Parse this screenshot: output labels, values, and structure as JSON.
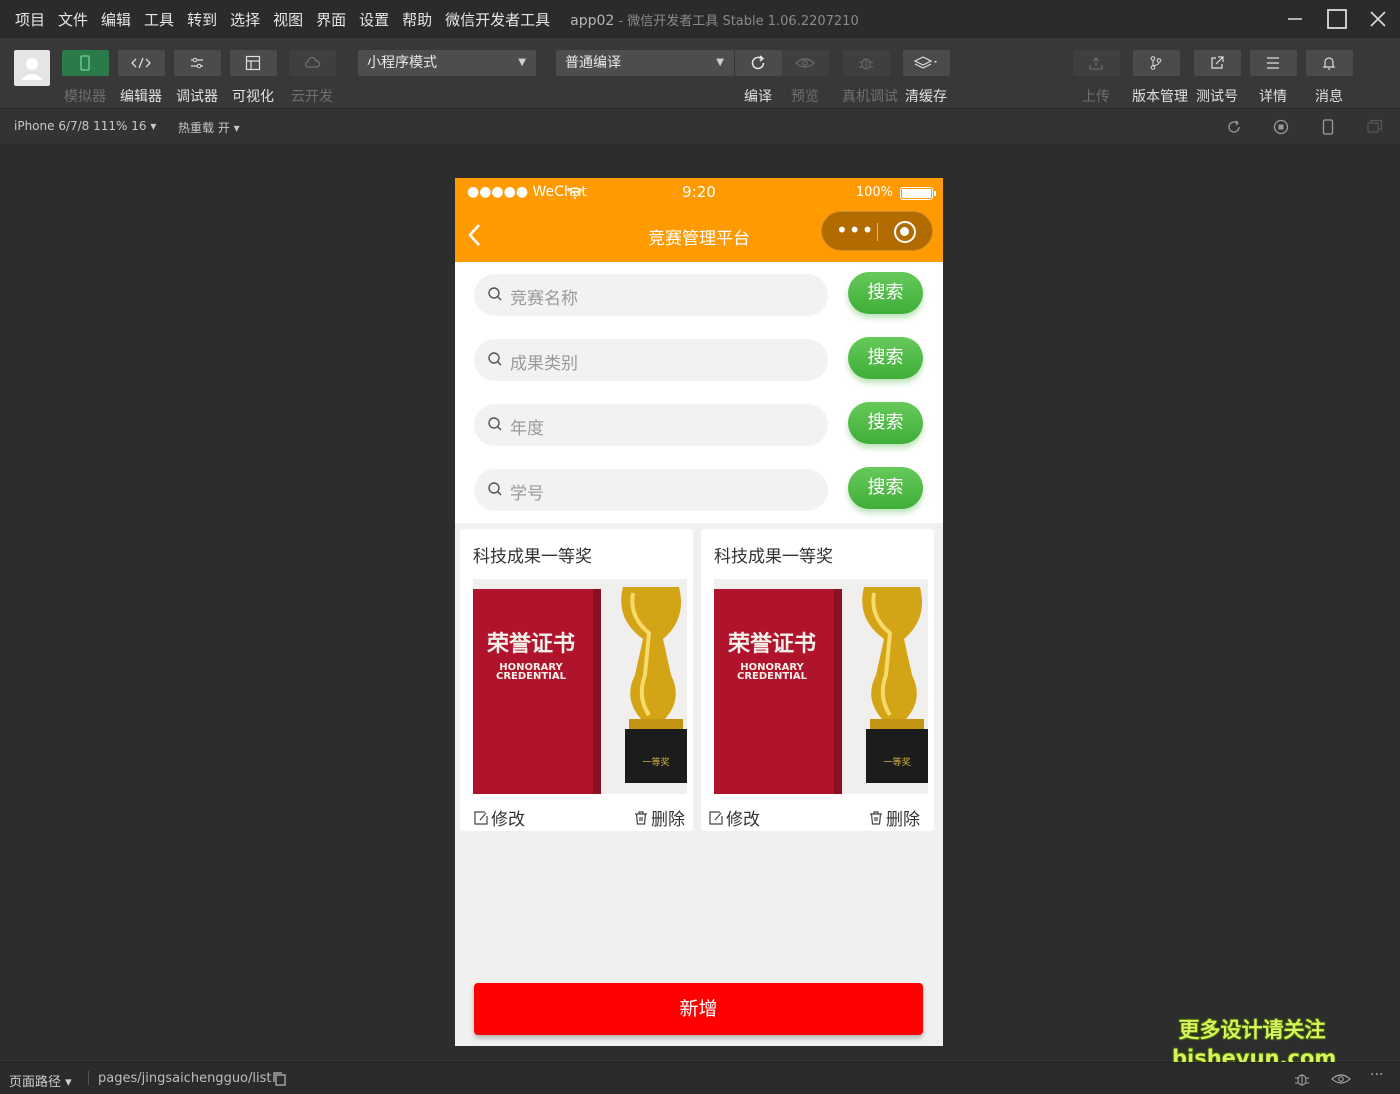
{
  "menubar": {
    "items": [
      "项目",
      "文件",
      "编辑",
      "工具",
      "转到",
      "选择",
      "视图",
      "界面",
      "设置",
      "帮助",
      "微信开发者工具"
    ],
    "app_name": "app02",
    "window_title": "- 微信开发者工具 Stable 1.06.2207210"
  },
  "toolbar": {
    "simulator": "模拟器",
    "editor": "编辑器",
    "debugger": "调试器",
    "visual": "可视化",
    "cloud": "云开发",
    "mode_select": "小程序模式",
    "compile_select": "普通编译",
    "compile": "编译",
    "preview": "预览",
    "device_debug": "真机调试",
    "clear_cache": "清缓存",
    "upload": "上传",
    "version_mgmt": "版本管理",
    "test_account": "测试号",
    "details": "详情",
    "messages": "消息"
  },
  "subbar": {
    "device": "iPhone 6/7/8 111% 16 ▾",
    "hot_reload": "热重载 开 ▾"
  },
  "phone": {
    "status": {
      "signal": "●●●●● WeChat",
      "time": "9:20",
      "battery": "100%"
    },
    "nav_title": "竞赛管理平台",
    "searches": [
      {
        "placeholder": "竞赛名称",
        "button": "搜索"
      },
      {
        "placeholder": "成果类别",
        "button": "搜索"
      },
      {
        "placeholder": "年度",
        "button": "搜索"
      },
      {
        "placeholder": "学号",
        "button": "搜索"
      }
    ],
    "cards": [
      {
        "title": "科技成果一等奖",
        "edit": "修改",
        "delete": "删除",
        "cert_cn": "荣誉证书",
        "cert_en1": "HONORARY",
        "cert_en2": "CREDENTIAL"
      },
      {
        "title": "科技成果一等奖",
        "edit": "修改",
        "delete": "删除",
        "cert_cn": "荣誉证书",
        "cert_en1": "HONORARY",
        "cert_en2": "CREDENTIAL"
      }
    ],
    "add_button": "新增"
  },
  "watermark": {
    "line1": "更多设计请关注",
    "line2": "bisheyun.com"
  },
  "bottombar": {
    "path_label": "页面路径 ▾",
    "path": "pages/jingsaichengguo/list"
  },
  "colors": {
    "nav_orange": "#ff9a00",
    "search_green": "#4bb842",
    "add_red": "#ff0000",
    "simulator_active": "#2a7a4a"
  }
}
